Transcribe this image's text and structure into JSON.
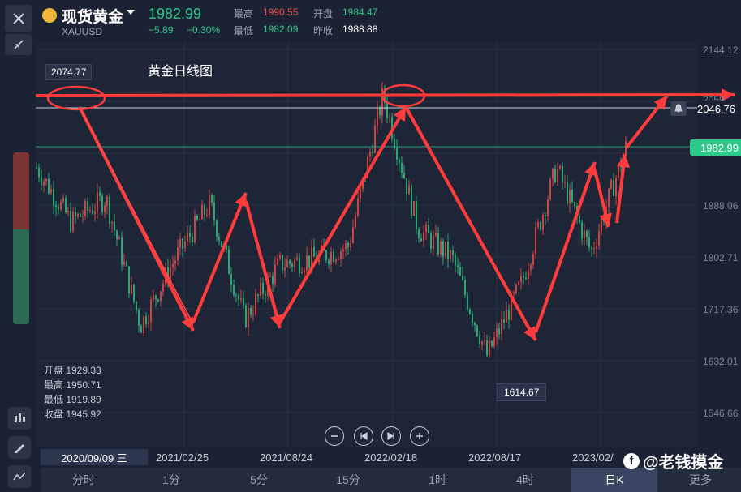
{
  "header": {
    "title": "现货黄金",
    "symbol": "XAUUSD",
    "price": "1982.99",
    "change": "−5.89",
    "change_pct": "−0.30%",
    "high_label": "最高",
    "high": "1990.55",
    "open_label": "开盘",
    "open": "1984.47",
    "low_label": "最低",
    "low": "1982.09",
    "prev_close_label": "昨收",
    "prev_close": "1988.88"
  },
  "chart_title": "黄金日线图",
  "y_axis": [
    "2144.12",
    "2059.",
    "1888.06",
    "1802.71",
    "1717.36",
    "1632.01",
    "1546.66"
  ],
  "x_axis": [
    "2021/02/25",
    "2021/08/24",
    "2022/02/18",
    "2022/08/17",
    "2023/02/"
  ],
  "cursor_date": "2020/09/09 三",
  "annotations": {
    "high_tag": "2074.77",
    "low_tag": "1614.67",
    "alert_price": "2046.76",
    "current_price": "1982.99"
  },
  "ohlc_panel": {
    "open": "开盘 1929.33",
    "high": "最高 1950.71",
    "low": "最低 1919.89",
    "close": "收盘 1945.92"
  },
  "tabs": [
    "分时",
    "1分",
    "5分",
    "15分",
    "1时",
    "4时",
    "日K",
    "更多"
  ],
  "active_tab": "日K",
  "watermark": "@老钱摸金",
  "colors": {
    "up": "#ee4a4a",
    "down": "#2ec88b",
    "arrow": "#ff3b3b",
    "bg": "#1b2233"
  },
  "chart_data": {
    "type": "candlestick",
    "xlabel": "",
    "ylabel": "",
    "ylim": [
      1546.66,
      2144.12
    ],
    "x": [
      "2020/09",
      "2020/11",
      "2021/01",
      "2021/03",
      "2021/05",
      "2021/06",
      "2021/08",
      "2021/10",
      "2021/12",
      "2022/01",
      "2022/03",
      "2022/05",
      "2022/07",
      "2022/09",
      "2022/11",
      "2023/01",
      "2023/02",
      "2023/03"
    ],
    "close": [
      1950,
      1860,
      1900,
      1690,
      1800,
      1890,
      1700,
      1790,
      1800,
      1820,
      2070,
      1850,
      1800,
      1640,
      1760,
      1950,
      1810,
      1983
    ],
    "high_point": 2074.77,
    "low_point": 1614.67
  }
}
